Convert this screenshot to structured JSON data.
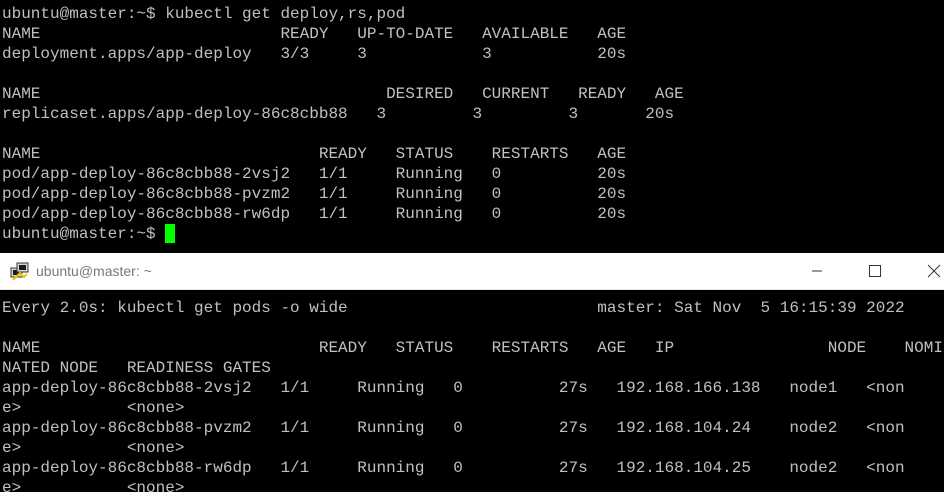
{
  "top_terminal": {
    "lines": [
      "ubuntu@master:~$ kubectl get deploy,rs,pod",
      "NAME                         READY   UP-TO-DATE   AVAILABLE   AGE",
      "deployment.apps/app-deploy   3/3     3            3           20s",
      "",
      "NAME                                    DESIRED   CURRENT   READY   AGE",
      "replicaset.apps/app-deploy-86c8cbb88   3         3         3       20s",
      "",
      "NAME                             READY   STATUS    RESTARTS   AGE",
      "pod/app-deploy-86c8cbb88-2vsj2   1/1     Running   0          20s",
      "pod/app-deploy-86c8cbb88-pvzm2   1/1     Running   0          20s",
      "pod/app-deploy-86c8cbb88-rw6dp   1/1     Running   0          20s"
    ],
    "prompt": "ubuntu@master:~$ "
  },
  "window": {
    "title": "ubuntu@master: ~",
    "icon": "putty-icon",
    "controls": [
      "minimize-icon",
      "maximize-icon",
      "close-icon"
    ]
  },
  "bottom_terminal": {
    "lines": [
      "Every 2.0s: kubectl get pods -o wide                          master: Sat Nov  5 16:15:39 2022",
      "",
      "NAME                             READY   STATUS    RESTARTS   AGE   IP                NODE    NOMI",
      "NATED NODE   READINESS GATES",
      "app-deploy-86c8cbb88-2vsj2   1/1     Running   0          27s   192.168.166.138   node1   <non",
      "e>           <none>",
      "app-deploy-86c8cbb88-pvzm2   1/1     Running   0          27s   192.168.104.24    node2   <non",
      "e>           <none>",
      "app-deploy-86c8cbb88-rw6dp   1/1     Running   0          27s   192.168.104.25    node2   <non",
      "e>           <none>"
    ]
  }
}
